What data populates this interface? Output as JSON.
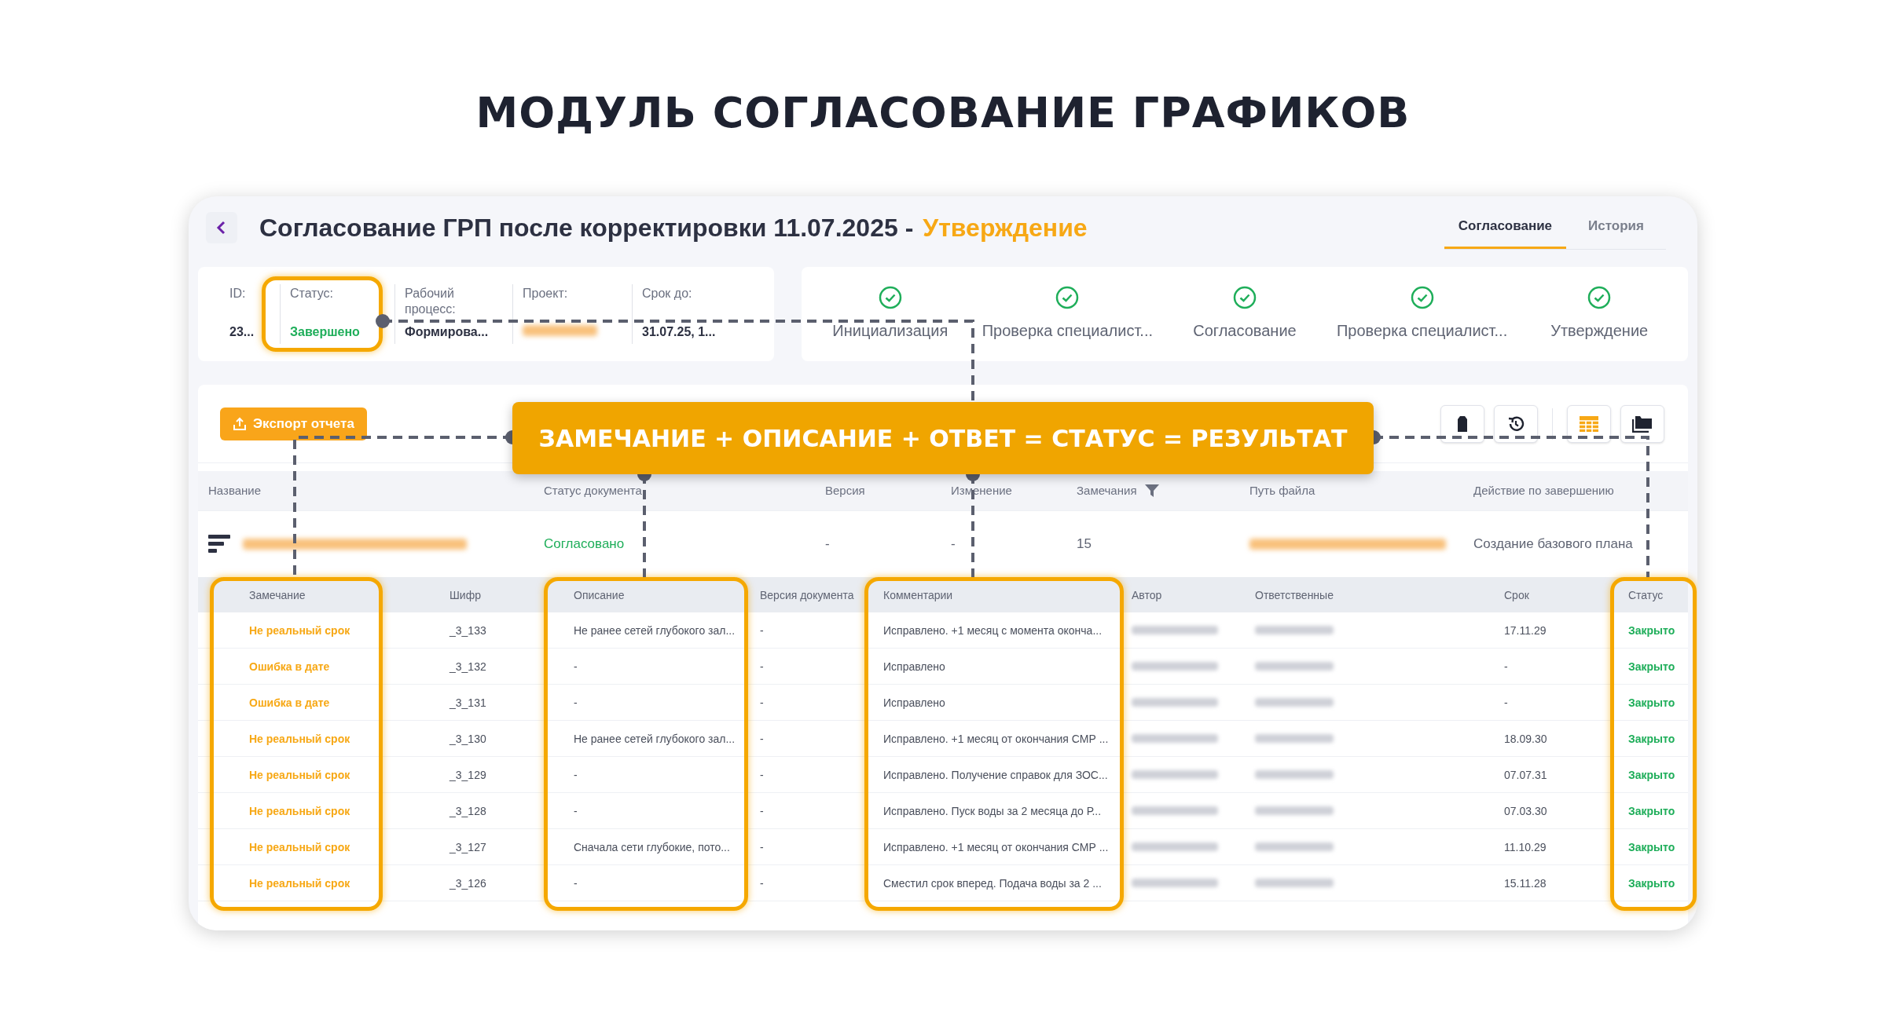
{
  "heading": "МОДУЛЬ СОГЛАСОВАНИЕ ГРАФИКОВ",
  "title": "Согласование ГРП после корректировки 11.07.2025 -",
  "title_stage": "Утверждение",
  "tabs": [
    {
      "label": "Согласование",
      "selected": true
    },
    {
      "label": "История",
      "selected": false
    }
  ],
  "info_fields": [
    {
      "label": "ID:",
      "value": "23...",
      "kind": "plain",
      "highlighted": false
    },
    {
      "label": "Статус:",
      "value": "Завершено",
      "kind": "status",
      "highlighted": true
    },
    {
      "label": "Рабочий процесс:",
      "value": "Формирова...",
      "kind": "strong",
      "highlighted": false
    },
    {
      "label": "Проект:",
      "kind": "redacted",
      "highlighted": false
    },
    {
      "label": "Срок до:",
      "value": "31.07.25, 1...",
      "kind": "strong",
      "highlighted": false
    }
  ],
  "steps": [
    {
      "label": "Инициализация",
      "done": true
    },
    {
      "label": "Проверка специалист...",
      "done": true
    },
    {
      "label": "Согласование",
      "done": true
    },
    {
      "label": "Проверка специалист...",
      "done": true
    },
    {
      "label": "Утверждение",
      "done": true
    }
  ],
  "export_button": "Экспорт отчета",
  "icon_buttons": [
    {
      "kind": "tag",
      "selected": false
    },
    {
      "kind": "history",
      "selected": false
    },
    {
      "kind": "table",
      "selected": true
    },
    {
      "kind": "folder",
      "selected": false
    }
  ],
  "banner": "ЗАМЕЧАНИЕ + ОПИСАНИЕ + ОТВЕТ = СТАТУС = РЕЗУЛЬТАТ",
  "documents_table": {
    "columns": [
      {
        "label": "Название",
        "filter": false
      },
      {
        "label": "Статус документа",
        "filter": false
      },
      {
        "label": "Версия",
        "filter": false
      },
      {
        "label": "Изменение",
        "filter": false
      },
      {
        "label": "Замечания",
        "filter": true
      },
      {
        "label": "Путь файла",
        "filter": false
      },
      {
        "label": "Действие по завершению",
        "filter": false
      }
    ],
    "rows": [
      {
        "cells": [
          {
            "kind": "name"
          },
          {
            "kind": "status",
            "text": "Согласовано"
          },
          {
            "kind": "text",
            "text": "-"
          },
          {
            "kind": "text",
            "text": "-"
          },
          {
            "kind": "text",
            "text": "15"
          },
          {
            "kind": "redacted"
          },
          {
            "kind": "text",
            "text": "Создание базового плана"
          }
        ]
      }
    ]
  },
  "remarks_table": {
    "columns": [
      {
        "label": "Замечание",
        "kind": "remark",
        "highlighted": true
      },
      {
        "label": "Шифр",
        "kind": "text",
        "highlighted": false
      },
      {
        "label": "Описание",
        "kind": "text",
        "highlighted": true
      },
      {
        "label": "Версия документа",
        "kind": "text",
        "highlighted": false
      },
      {
        "label": "Комментарии",
        "kind": "text",
        "highlighted": true
      },
      {
        "label": "Автор",
        "kind": "redacted",
        "highlighted": false
      },
      {
        "label": "Ответственные",
        "kind": "redacted",
        "highlighted": false
      },
      {
        "label": "Срок",
        "kind": "text",
        "highlighted": false
      },
      {
        "label": "Статус",
        "kind": "status",
        "highlighted": true
      }
    ],
    "rows": [
      [
        "Не реальный срок",
        "_3_133",
        "Не ранее сетей глубокого зал...",
        "-",
        "Исправлено. +1 месяц с момента оконча...",
        "",
        "",
        "17.11.29",
        "Закрыто"
      ],
      [
        "Ошибка в дате",
        "_3_132",
        "-",
        "-",
        "Исправлено",
        "",
        "",
        "-",
        "Закрыто"
      ],
      [
        "Ошибка в дате",
        "_3_131",
        "-",
        "-",
        "Исправлено",
        "",
        "",
        "-",
        "Закрыто"
      ],
      [
        "Не реальный срок",
        "_3_130",
        "Не ранее сетей глубокого зал...",
        "-",
        "Исправлено. +1 месяц от окончания СМР ...",
        "",
        "",
        "18.09.30",
        "Закрыто"
      ],
      [
        "Не реальный срок",
        "_3_129",
        "-",
        "-",
        "Исправлено. Получение справок для ЗОС...",
        "",
        "",
        "07.07.31",
        "Закрыто"
      ],
      [
        "Не реальный срок",
        "_3_128",
        "-",
        "-",
        "Исправлено. Пуск воды за 2 месяца до Р...",
        "",
        "",
        "07.03.30",
        "Закрыто"
      ],
      [
        "Не реальный срок",
        "_3_127",
        "Сначала сети глубокие, пото...",
        "-",
        "Исправлено. +1 месяц от окончания СМР ...",
        "",
        "",
        "11.10.29",
        "Закрыто"
      ],
      [
        "Не реальный срок",
        "_3_126",
        "-",
        "-",
        "Сместил срок вперед. Подача воды за 2 ...",
        "",
        "",
        "15.11.28",
        "Закрыто"
      ]
    ]
  }
}
